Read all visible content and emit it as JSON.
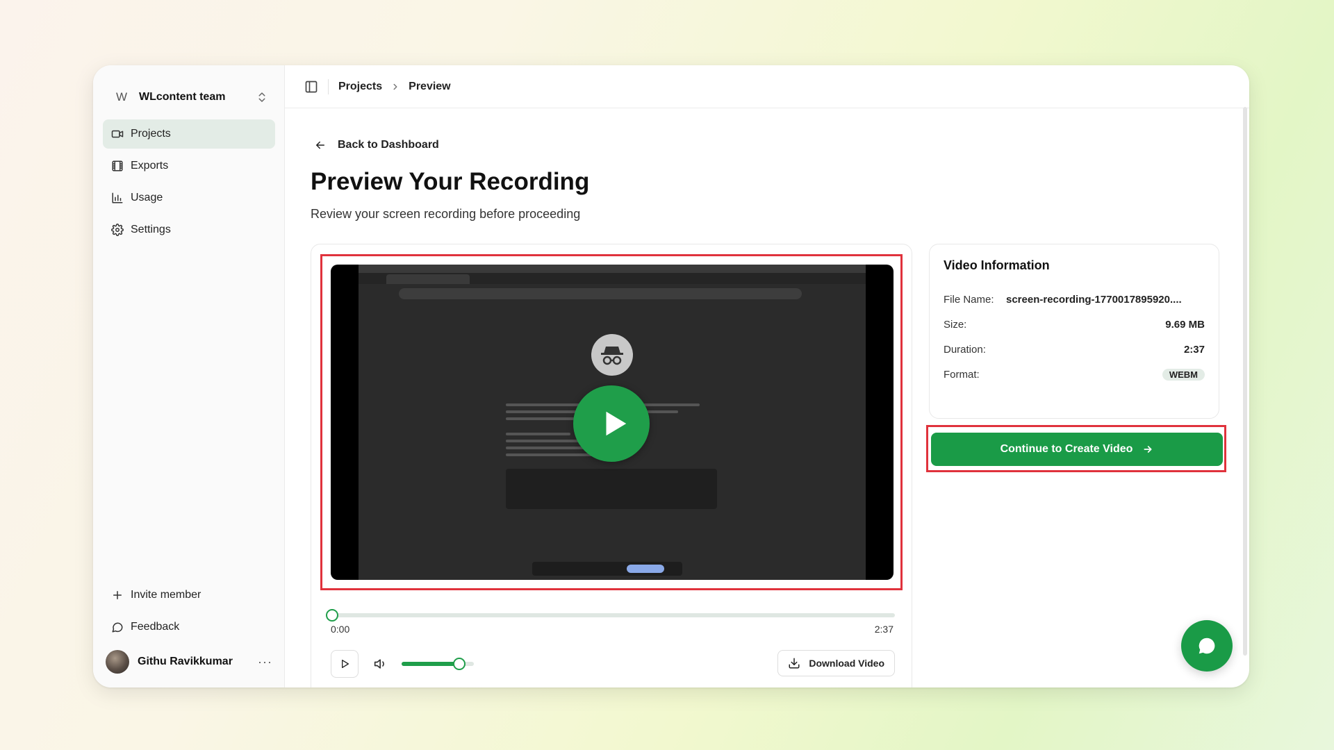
{
  "sidebar": {
    "team": {
      "avatar_letter": "W",
      "name": "WLcontent team"
    },
    "nav": [
      {
        "label": "Projects",
        "icon": "video-icon",
        "active": true
      },
      {
        "label": "Exports",
        "icon": "film-icon",
        "active": false
      },
      {
        "label": "Usage",
        "icon": "bar-chart-icon",
        "active": false
      },
      {
        "label": "Settings",
        "icon": "gear-icon",
        "active": false
      }
    ],
    "bottom": [
      {
        "label": "Invite member",
        "icon": "plus-icon"
      },
      {
        "label": "Feedback",
        "icon": "message-icon"
      }
    ],
    "user": {
      "name": "Githu Ravikkumar",
      "more": "···"
    }
  },
  "header": {
    "breadcrumb": [
      "Projects",
      "Preview"
    ]
  },
  "main": {
    "back_label": "Back to Dashboard",
    "title": "Preview Your Recording",
    "subtitle": "Review your screen recording before proceeding"
  },
  "player": {
    "current_time": "0:00",
    "total_time": "2:37",
    "progress": 0.0,
    "volume": 0.8,
    "download_label": "Download Video"
  },
  "video_info": {
    "title": "Video Information",
    "file_name_label": "File Name:",
    "file_name": "screen-recording-1770017895920....",
    "size_label": "Size:",
    "size": "9.69 MB",
    "duration_label": "Duration:",
    "duration": "2:37",
    "format_label": "Format:",
    "format": "WEBM"
  },
  "cta": {
    "label": "Continue to Create Video"
  },
  "colors": {
    "accent": "#1a9b47",
    "highlight": "#e0323c",
    "active_nav": "#e3ece6"
  }
}
